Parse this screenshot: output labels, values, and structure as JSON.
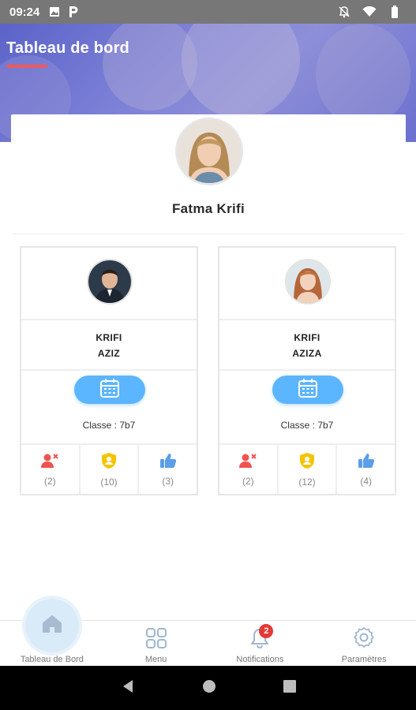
{
  "status_bar": {
    "time": "09:24",
    "left_icons": [
      "image-icon",
      "parking-icon"
    ],
    "right_icons": [
      "notifications-off-icon",
      "wifi-icon",
      "battery-icon"
    ]
  },
  "header": {
    "title": "Tableau de bord",
    "accent_color": "#ef5a5a"
  },
  "profile": {
    "name": "Fatma Krifi"
  },
  "children": [
    {
      "last_name": "KRIFI",
      "first_name": "AZIZ",
      "classe": "Classe : 7b7",
      "stats": {
        "absences": "(2)",
        "sanctions": "(10)",
        "likes": "(3)"
      }
    },
    {
      "last_name": "KRIFI",
      "first_name": "AZIZA",
      "classe": "Classe : 7b7",
      "stats": {
        "absences": "(2)",
        "sanctions": "(12)",
        "likes": "(4)"
      }
    }
  ],
  "bottom_nav": {
    "items": [
      {
        "label": "Tableau de Bord",
        "icon": "home-icon"
      },
      {
        "label": "Menu",
        "icon": "grid-icon"
      },
      {
        "label": "Notifications",
        "icon": "bell-icon",
        "badge": "2"
      },
      {
        "label": "Paramètres",
        "icon": "gear-icon"
      }
    ]
  },
  "colors": {
    "primary": "#5cb5ff",
    "absence": "#ef5350",
    "sanction": "#f5c400",
    "like": "#5a9fe8",
    "badge": "#e53935"
  }
}
